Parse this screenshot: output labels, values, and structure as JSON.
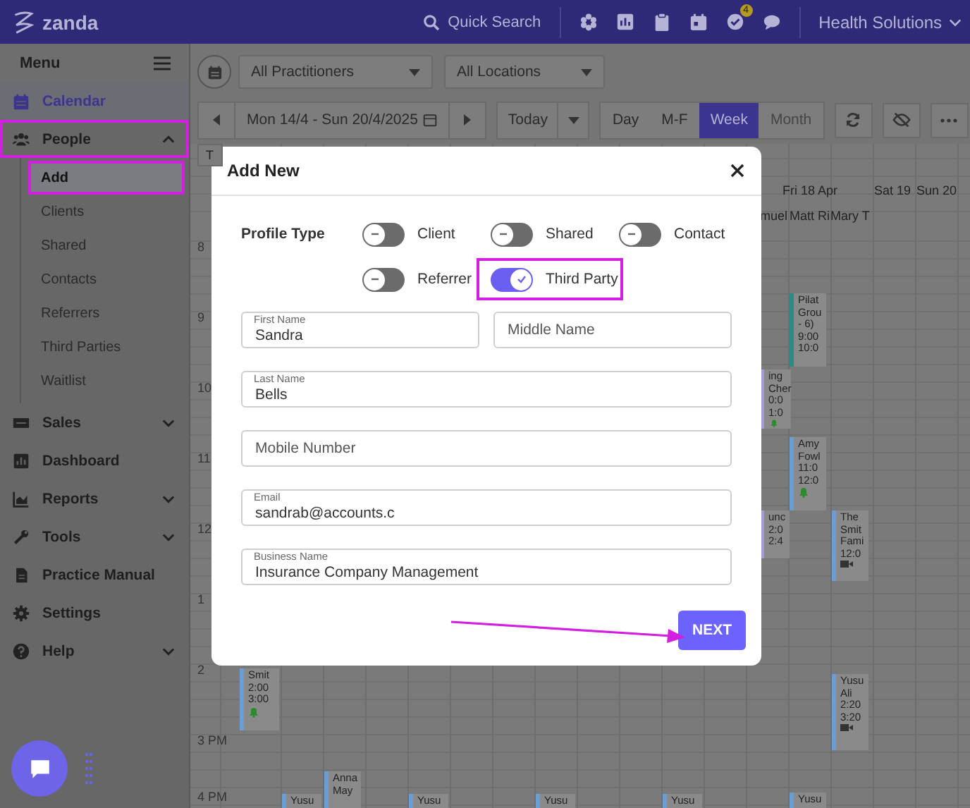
{
  "topbar": {
    "logo": "zanda",
    "search": "Quick Search",
    "tasks_badge": "4",
    "account": "Health Solutions"
  },
  "sidebar": {
    "title": "Menu",
    "items": [
      {
        "label": "Calendar",
        "selected": true,
        "highlighted": false
      },
      {
        "label": "People",
        "selected": false,
        "highlighted": true,
        "expanded": true,
        "children": [
          {
            "label": "Add",
            "selected": true,
            "highlighted": true
          },
          {
            "label": "Clients",
            "selected": false,
            "highlighted": false
          },
          {
            "label": "Shared",
            "selected": false,
            "highlighted": false
          },
          {
            "label": "Contacts",
            "selected": false,
            "highlighted": false
          },
          {
            "label": "Referrers",
            "selected": false,
            "highlighted": false
          },
          {
            "label": "Third Parties",
            "selected": false,
            "highlighted": false
          },
          {
            "label": "Waitlist",
            "selected": false,
            "highlighted": false
          }
        ]
      },
      {
        "label": "Sales",
        "selected": false,
        "highlighted": false,
        "expanded": false
      },
      {
        "label": "Dashboard",
        "selected": false,
        "highlighted": false
      },
      {
        "label": "Reports",
        "selected": false,
        "highlighted": false,
        "expanded": false
      },
      {
        "label": "Tools",
        "selected": false,
        "highlighted": false,
        "expanded": false
      },
      {
        "label": "Practice Manual",
        "selected": false,
        "highlighted": false
      },
      {
        "label": "Settings",
        "selected": false,
        "highlighted": false
      },
      {
        "label": "Help",
        "selected": false,
        "highlighted": false,
        "expanded": false
      }
    ]
  },
  "calendar_toolbar": {
    "practitioners": "All Practitioners",
    "locations": "All Locations",
    "date_range": "Mon 14/4 - Sun 20/4/2025",
    "today": "Today",
    "views": [
      {
        "label": "Day",
        "selected": false,
        "disabled": false
      },
      {
        "label": "M-F",
        "selected": false,
        "disabled": false
      },
      {
        "label": "Week",
        "selected": true,
        "disabled": false
      },
      {
        "label": "Month",
        "selected": false,
        "disabled": true
      }
    ]
  },
  "calendar": {
    "tab_fragment": "T",
    "day_headers": [
      "Fri 18 Apr",
      "Sat 19",
      "Sun 20"
    ],
    "practitioners": [
      "muel",
      "Matt Ri",
      "Mary T"
    ],
    "hours": [
      "8",
      "9",
      "10",
      "11",
      "12",
      "1",
      "2",
      "3 PM",
      "4 PM"
    ],
    "events": [
      {
        "lines": [
          "Pilat",
          "Grou",
          "- 6)",
          "9:00",
          "10:0"
        ],
        "color": "#2a8c86",
        "kind": "plain"
      },
      {
        "lines": [
          "ing",
          "Cher",
          "0:0",
          "1:0"
        ],
        "color": "#a59ad8",
        "kind": "reminder"
      },
      {
        "lines": [
          "Amy",
          "Fowl",
          "11:0",
          "12:0"
        ],
        "color": "#6a9fd6",
        "kind": "reminder"
      },
      {
        "lines": [
          "unc",
          "2:0",
          "2:4"
        ],
        "color": "#a59ad8",
        "kind": "plain"
      },
      {
        "lines": [
          "The",
          "Smit",
          "Fami",
          "12:0"
        ],
        "color": "#6a9fd6",
        "kind": "telehealth"
      },
      {
        "lines": [
          "Yusu",
          "Ali",
          "2:20",
          "3:20"
        ],
        "color": "#6a9fd6",
        "kind": "telehealth"
      },
      {
        "lines": [
          "Yusu"
        ],
        "color": "#6a9fd6",
        "kind": "plain"
      },
      {
        "lines": [
          "Smit",
          "2:00",
          "3:00"
        ],
        "color": "#6a9fd6",
        "kind": "reminder"
      },
      {
        "lines": [
          "Anna",
          "May"
        ],
        "color": "#6a9fd6",
        "kind": "plain"
      },
      {
        "lines": [
          "Yusu"
        ],
        "color": "#6a9fd6",
        "kind": "plain"
      },
      {
        "lines": [
          "Yusu"
        ],
        "color": "#6a9fd6",
        "kind": "plain"
      },
      {
        "lines": [
          "Yusu"
        ],
        "color": "#6a9fd6",
        "kind": "plain"
      },
      {
        "lines": [
          "Yusu"
        ],
        "color": "#6a9fd6",
        "kind": "plain"
      }
    ]
  },
  "modal": {
    "title": "Add New",
    "profile_type": {
      "label": "Profile Type",
      "options": [
        {
          "label": "Client",
          "on": false,
          "highlighted": false
        },
        {
          "label": "Shared",
          "on": false,
          "highlighted": false
        },
        {
          "label": "Contact",
          "on": false,
          "highlighted": false
        },
        {
          "label": "Referrer",
          "on": false,
          "highlighted": false
        },
        {
          "label": "Third Party",
          "on": true,
          "highlighted": true
        }
      ]
    },
    "fields": [
      {
        "label": "First Name",
        "value": "Sandra"
      },
      {
        "placeholder": "Middle Name"
      },
      {
        "label": "Last Name",
        "value": "Bells"
      },
      {
        "placeholder": "Mobile Number"
      },
      {
        "label": "Email",
        "value": "sandrab@accounts.c"
      },
      {
        "label": "Business Name",
        "value": "Insurance Company Management"
      }
    ],
    "next": "NEXT"
  }
}
